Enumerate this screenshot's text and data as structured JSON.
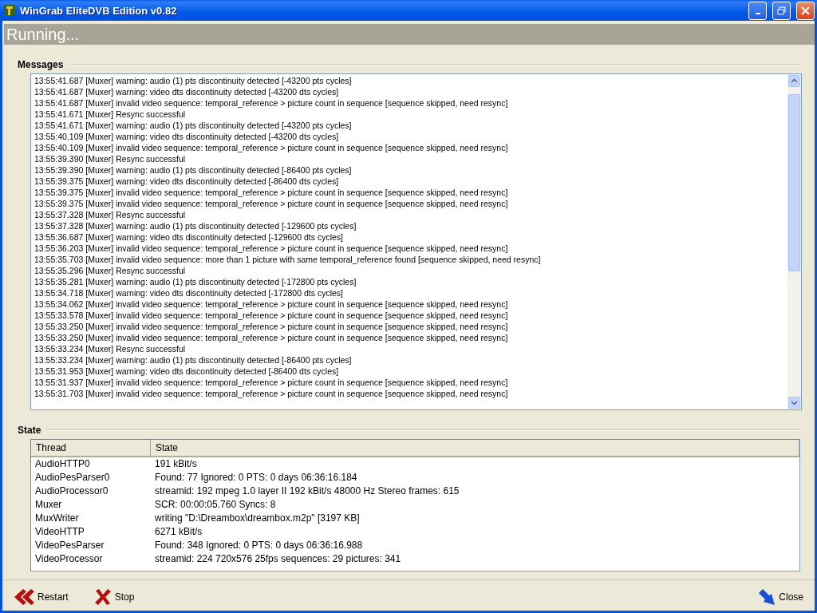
{
  "window": {
    "title": "WinGrab EliteDVB Edition v0.82"
  },
  "status_header": "Running...",
  "messages": {
    "title": "Messages",
    "lines": [
      "13:55:41.687 [Muxer] warning: audio (1) pts discontinuity detected [-43200 pts cycles]",
      "13:55:41.687 [Muxer] warning: video dts discontinuity detected [-43200 dts cycles]",
      "13:55:41.687 [Muxer] invalid video sequence: temporal_reference > picture count in sequence [sequence skipped, need resync]",
      "13:55:41.671 [Muxer] Resync successful",
      "13:55:41.671 [Muxer] warning: audio (1) pts discontinuity detected [-43200 pts cycles]",
      "13:55:40.109 [Muxer] warning: video dts discontinuity detected [-43200 dts cycles]",
      "13:55:40.109 [Muxer] invalid video sequence: temporal_reference > picture count in sequence [sequence skipped, need resync]",
      "13:55:39.390 [Muxer] Resync successful",
      "13:55:39.390 [Muxer] warning: audio (1) pts discontinuity detected [-86400 pts cycles]",
      "13:55:39.375 [Muxer] warning: video dts discontinuity detected [-86400 dts cycles]",
      "13:55:39.375 [Muxer] invalid video sequence: temporal_reference > picture count in sequence [sequence skipped, need resync]",
      "13:55:39.375 [Muxer] invalid video sequence: temporal_reference > picture count in sequence [sequence skipped, need resync]",
      "13:55:37.328 [Muxer] Resync successful",
      "13:55:37.328 [Muxer] warning: audio (1) pts discontinuity detected [-129600 pts cycles]",
      "13:55:36.687 [Muxer] warning: video dts discontinuity detected [-129600 dts cycles]",
      "13:55:36.203 [Muxer] invalid video sequence: temporal_reference > picture count in sequence [sequence skipped, need resync]",
      "13:55:35.703 [Muxer] invalid video sequence: more than 1 picture with same temporal_reference found [sequence skipped, need resync]",
      "13:55:35.296 [Muxer] Resync successful",
      "13:55:35.281 [Muxer] warning: audio (1) pts discontinuity detected [-172800 pts cycles]",
      "13:55:34.718 [Muxer] warning: video dts discontinuity detected [-172800 dts cycles]",
      "13:55:34.062 [Muxer] invalid video sequence: temporal_reference > picture count in sequence [sequence skipped, need resync]",
      "13:55:33.578 [Muxer] invalid video sequence: temporal_reference > picture count in sequence [sequence skipped, need resync]",
      "13:55:33.250 [Muxer] invalid video sequence: temporal_reference > picture count in sequence [sequence skipped, need resync]",
      "13:55:33.250 [Muxer] invalid video sequence: temporal_reference > picture count in sequence [sequence skipped, need resync]",
      "13:55:33.234 [Muxer] Resync successful",
      "13:55:33.234 [Muxer] warning: audio (1) pts discontinuity detected [-86400 pts cycles]",
      "13:55:31.953 [Muxer] warning: video dts discontinuity detected [-86400 dts cycles]",
      "13:55:31.937 [Muxer] invalid video sequence: temporal_reference > picture count in sequence [sequence skipped, need resync]",
      "13:55:31.703 [Muxer] invalid video sequence: temporal_reference > picture count in sequence [sequence skipped, need resync]"
    ]
  },
  "state": {
    "title": "State",
    "table": {
      "columns": [
        "Thread",
        "State"
      ],
      "rows": [
        [
          "AudioHTTP0",
          "191 kBit/s"
        ],
        [
          "AudioPesParser0",
          "Found: 77 Ignored: 0 PTS: 0 days 06:36:16.184"
        ],
        [
          "AudioProcessor0",
          "streamid: 192 mpeg 1.0 layer II 192 kBit/s 48000 Hz Stereo frames: 615"
        ],
        [
          "Muxer",
          "SCR: 00:00:05.760 Syncs: 8"
        ],
        [
          "MuxWriter",
          "writing \"D:\\Dreambox\\dreambox.m2p\" [3197 KB]"
        ],
        [
          "VideoHTTP",
          "6271 kBit/s"
        ],
        [
          "VideoPesParser",
          "Found: 348 Ignored: 0 PTS: 0 days 06:36:16.988"
        ],
        [
          "VideoProcessor",
          "streamid: 224 720x576 25fps sequences: 29 pictures: 341"
        ]
      ]
    }
  },
  "buttons": [
    {
      "kind": "restart",
      "label": "Restart"
    },
    {
      "kind": "stop",
      "label": "Stop"
    },
    {
      "kind": "close",
      "label": "Close"
    }
  ]
}
